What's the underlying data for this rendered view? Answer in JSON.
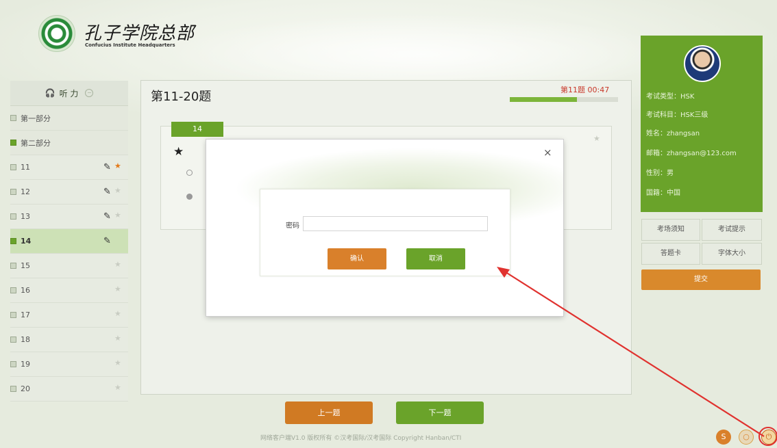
{
  "brand": {
    "cn": "孔子学院总部",
    "en": "Confucius Institute Headquarters"
  },
  "sidebar": {
    "section": "听 力",
    "parts": [
      "第一部分",
      "第二部分"
    ],
    "items": [
      {
        "label": "11",
        "flagged": true,
        "active": false
      },
      {
        "label": "12",
        "flagged": false,
        "active": false
      },
      {
        "label": "13",
        "flagged": false,
        "active": false
      },
      {
        "label": "14",
        "flagged": false,
        "active": true
      },
      {
        "label": "15",
        "flagged": false,
        "active": false
      },
      {
        "label": "16",
        "flagged": false,
        "active": false
      },
      {
        "label": "17",
        "flagged": false,
        "active": false
      },
      {
        "label": "18",
        "flagged": false,
        "active": false
      },
      {
        "label": "19",
        "flagged": false,
        "active": false
      },
      {
        "label": "20",
        "flagged": false,
        "active": false
      }
    ]
  },
  "main": {
    "title": "第11-20题",
    "timer": "第11题 00:47",
    "progress": 0.62,
    "question_number": "14"
  },
  "nav": {
    "prev": "上一题",
    "next": "下一题"
  },
  "footer": "网络客户端V1.0 版权所有 ©汉考国际/汉考国际 Copyright Hanban/CTI",
  "profile": {
    "exam_type": "考试类型：HSK",
    "exam_subject": "考试科目：HSK三级",
    "name": "姓名：zhangsan",
    "email": "邮箱：zhangsan@123.com",
    "gender": "性别：男",
    "nationality": "国籍：中国"
  },
  "side_buttons": {
    "notice": "考场须知",
    "hint": "考试提示",
    "answer_card": "答题卡",
    "font_size": "字体大小",
    "submit": "提交"
  },
  "dialog": {
    "close": "×",
    "password_label": "密码",
    "password_value": "",
    "ok": "确认",
    "cancel": "取消"
  },
  "colors": {
    "green": "#6aa32a",
    "orange": "#d9802b",
    "timer_red": "#c8382a",
    "annotation_red": "#e0322f"
  },
  "icons": {
    "headphones": "headphones-icon",
    "pen": "pen-icon",
    "star": "star-icon",
    "close": "close-icon",
    "power": "power-icon"
  }
}
